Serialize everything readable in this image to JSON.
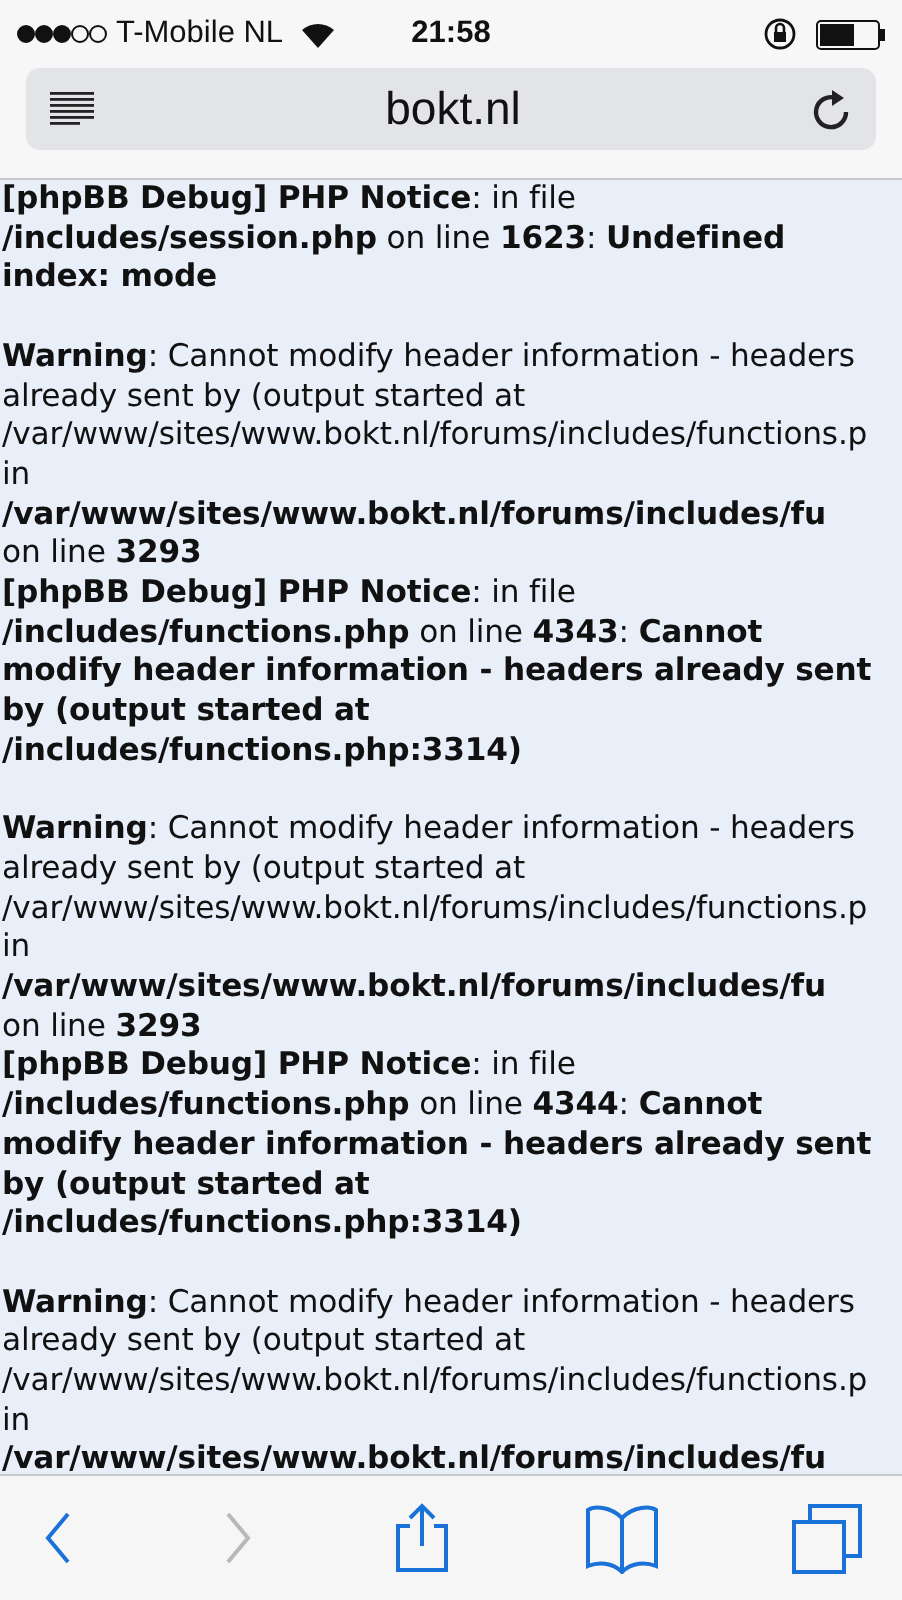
{
  "status_bar": {
    "carrier": "T-Mobile NL",
    "time": "21:58"
  },
  "address_bar": {
    "url": "bokt.nl"
  },
  "messages": [
    {
      "kind": "notice",
      "lines": [
        "**[phpBB Debug] PHP Notice**: in file",
        "**/includes/session.php** on line **1623**: **Undefined**",
        "**index: mode**"
      ]
    },
    {
      "kind": "warning",
      "lines": [
        "**Warning**: Cannot modify header information - headers",
        "already sent by (output started at",
        "/var/www/sites/www.bokt.nl/forums/includes/functions.p",
        "in",
        "**/var/www/sites/www.bokt.nl/forums/includes/fu**",
        "on line **3293**"
      ]
    },
    {
      "kind": "notice",
      "lines": [
        "**[phpBB Debug] PHP Notice**: in file",
        "**/includes/functions.php** on line **4343**: **Cannot**",
        "**modify header information - headers already sent**",
        "**by (output started at**",
        "**/includes/functions.php:3314)**"
      ]
    },
    {
      "kind": "warning",
      "lines": [
        "**Warning**: Cannot modify header information - headers",
        "already sent by (output started at",
        "/var/www/sites/www.bokt.nl/forums/includes/functions.p",
        "in",
        "**/var/www/sites/www.bokt.nl/forums/includes/fu**",
        "on line **3293**"
      ]
    },
    {
      "kind": "notice",
      "lines": [
        "**[phpBB Debug] PHP Notice**: in file",
        "**/includes/functions.php** on line **4344**: **Cannot**",
        "**modify header information - headers already sent**",
        "**by (output started at**",
        "**/includes/functions.php:3314)**"
      ]
    },
    {
      "kind": "warning",
      "lines": [
        "**Warning**: Cannot modify header information - headers",
        "already sent by (output started at",
        "/var/www/sites/www.bokt.nl/forums/includes/functions.p",
        "in",
        "**/var/www/sites/www.bokt.nl/forums/includes/fu**"
      ]
    }
  ],
  "toolbar": [
    {
      "kind": "back",
      "disabled": false
    },
    {
      "kind": "forward",
      "disabled": true
    },
    {
      "kind": "share",
      "disabled": false
    },
    {
      "kind": "bookmarks",
      "disabled": false
    },
    {
      "kind": "tabs",
      "disabled": false
    }
  ]
}
